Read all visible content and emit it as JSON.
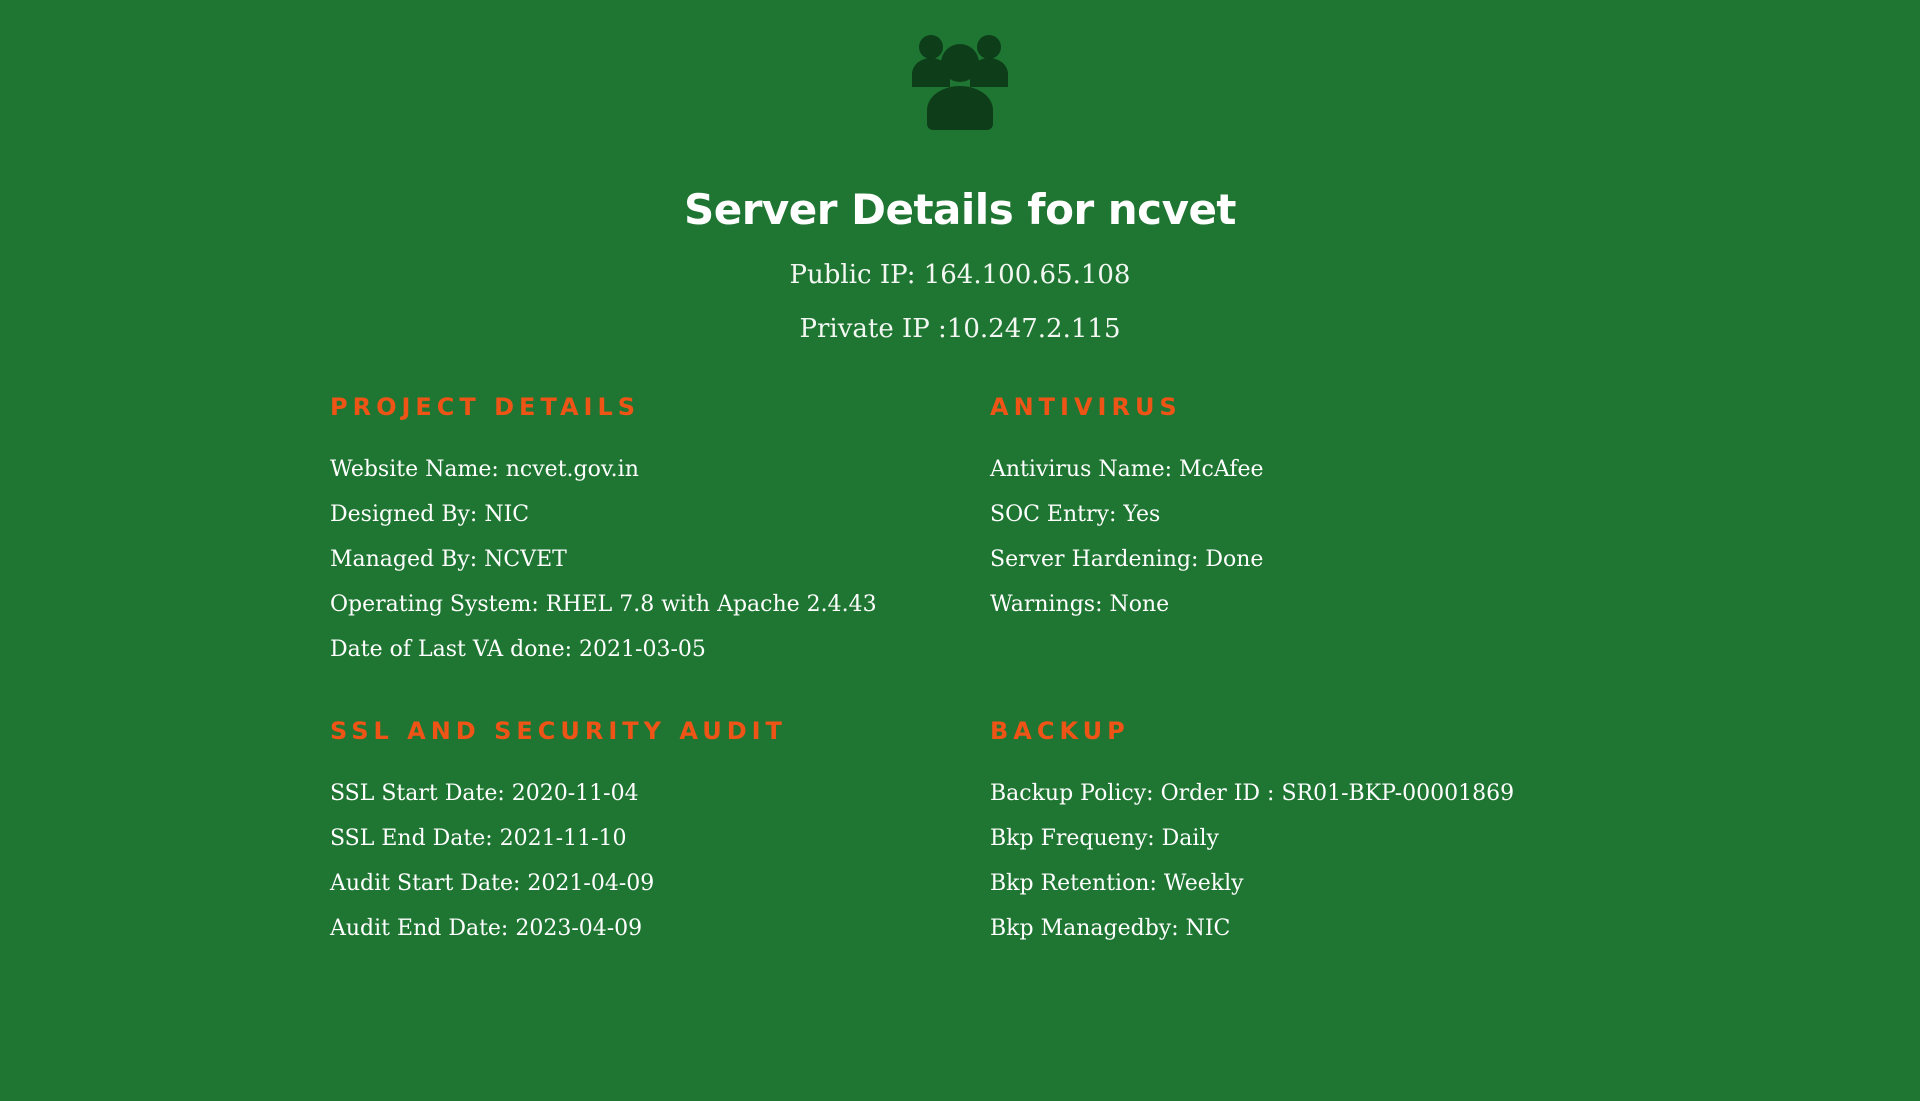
{
  "header": {
    "icon": "users-group-icon",
    "title": "Server Details for ncvet",
    "public_ip": "Public IP: 164.100.65.108",
    "private_ip": "Private IP :10.247.2.115"
  },
  "colors": {
    "background": "#1f7632",
    "accent": "#ef5417",
    "icon": "#0e3d19",
    "text": "#ffffff"
  },
  "sections": {
    "project": {
      "heading": "PROJECT DETAILS",
      "items": [
        "Website Name: ncvet.gov.in",
        "Designed By: NIC",
        "Managed By: NCVET",
        "Operating System: RHEL 7.8 with Apache 2.4.43",
        "Date of Last VA done: 2021-03-05"
      ]
    },
    "antivirus": {
      "heading": "ANTIVIRUS",
      "items": [
        "Antivirus Name: McAfee",
        "SOC Entry: Yes",
        "Server Hardening: Done",
        "Warnings: None"
      ]
    },
    "ssl": {
      "heading": "SSL AND SECURITY AUDIT",
      "items": [
        "SSL Start Date: 2020-11-04",
        "SSL End Date: 2021-11-10",
        "Audit Start Date: 2021-04-09",
        "Audit End Date: 2023-04-09"
      ]
    },
    "backup": {
      "heading": "BACKUP",
      "items": [
        "Backup Policy: Order ID : SR01-BKP-00001869",
        "Bkp Frequeny: Daily",
        "Bkp Retention: Weekly",
        "Bkp Managedby: NIC"
      ]
    }
  }
}
